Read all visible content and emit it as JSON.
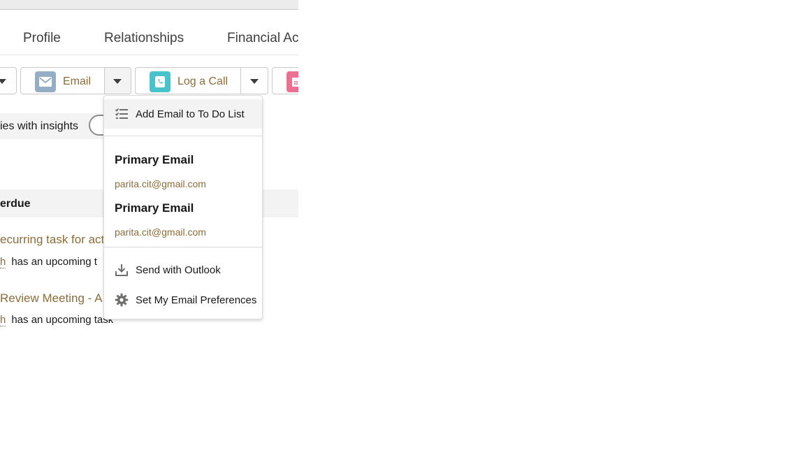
{
  "tabs": [
    {
      "label": "Profile"
    },
    {
      "label": "Relationships"
    },
    {
      "label": "Financial Ac"
    }
  ],
  "actions": {
    "email": {
      "label": "Email",
      "icon": "envelope-icon",
      "color": "#95aec5"
    },
    "log_call": {
      "label": "Log a Call",
      "icon": "phone-icon",
      "color": "#48c3cc"
    },
    "event": {
      "icon": "calendar-icon",
      "color": "#eb7092"
    }
  },
  "insights": {
    "label": "ies with insights",
    "toggle_on": false
  },
  "overdue": {
    "label": "erdue"
  },
  "tasks": [
    {
      "title": "ecurring task for act",
      "who": "h",
      "text": "has an upcoming t"
    },
    {
      "title": "Review Meeting - A",
      "who": "h",
      "text": "has an upcoming task"
    }
  ],
  "email_menu": {
    "add_todo": "Add Email to To Do List",
    "sections": [
      {
        "heading": "Primary Email",
        "address": "parita.cit@gmail.com"
      },
      {
        "heading": "Primary Email",
        "address": "parita.cit@gmail.com"
      }
    ],
    "send_outlook": "Send with Outlook",
    "preferences": "Set My Email Preferences"
  },
  "colors": {
    "link": "#8a6d3b",
    "text": "#181818",
    "border": "#c9c9c9"
  }
}
